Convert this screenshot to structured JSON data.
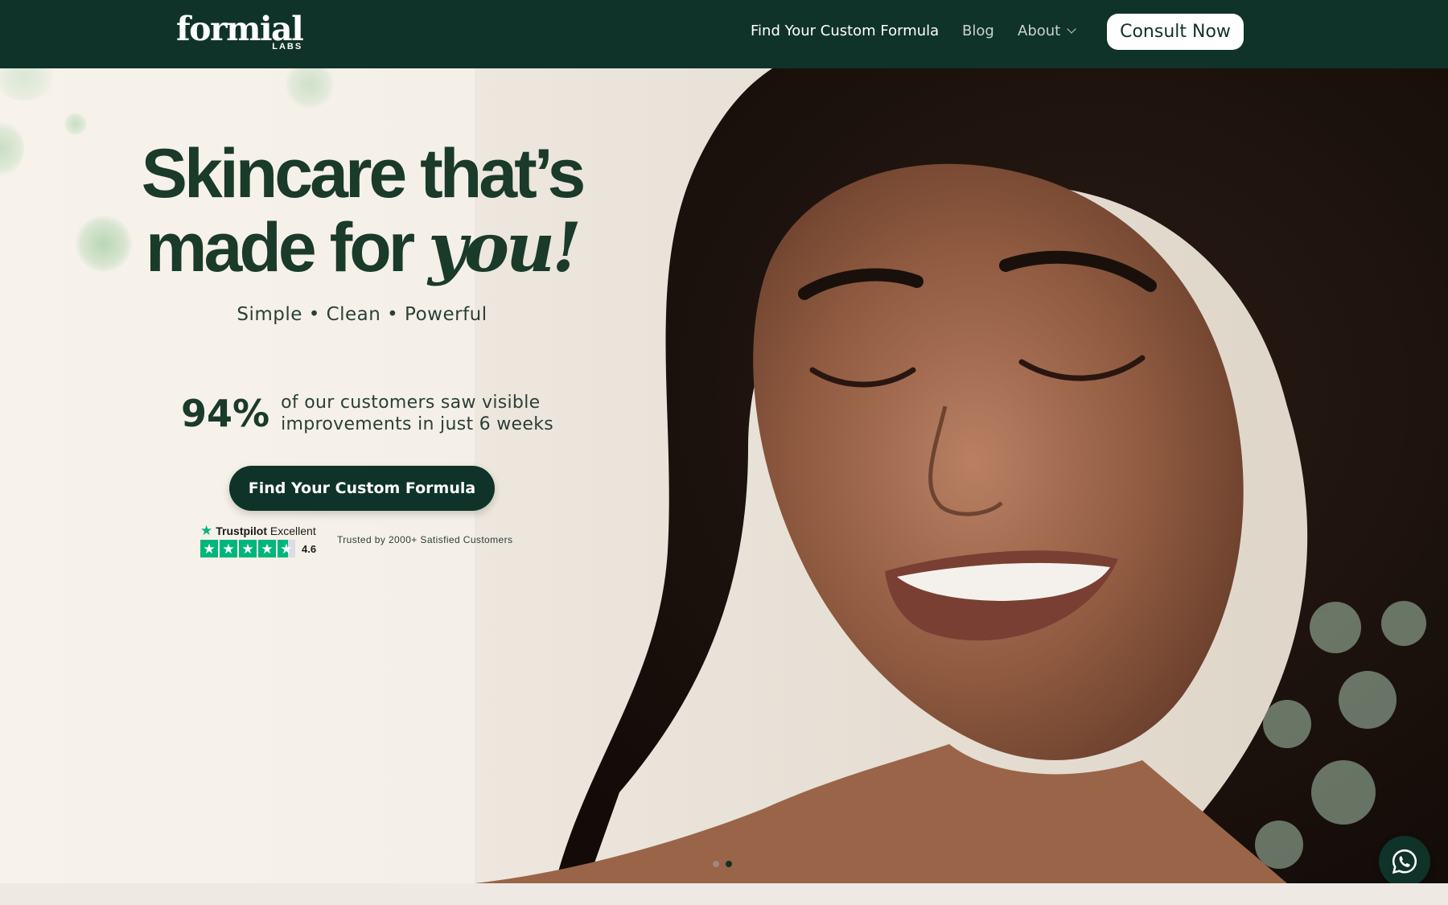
{
  "header": {
    "logo_text": "formial",
    "logo_sub": "LABS",
    "nav": {
      "custom_formula": "Find Your Custom Formula",
      "blog": "Blog",
      "about": "About"
    },
    "consult_label": "Consult Now"
  },
  "hero": {
    "headline_line1": "Skincare that’s",
    "headline_line2": "made for",
    "headline_accent": "you!",
    "tagline": "Simple • Clean • Powerful",
    "stat_value": "94%",
    "stat_line1": "of our customers saw visible",
    "stat_line2": "improvements in just 6 weeks",
    "cta_label": "Find Your Custom Formula",
    "trustpilot": {
      "brand": "Trustpilot",
      "rating_word": "Excellent",
      "score": "4.6",
      "trusted_text": "Trusted by 2000+ Satisfied Customers"
    },
    "carousel": {
      "slides": 2,
      "active": 2
    }
  },
  "icons": {
    "about_dropdown": "chevron-down-icon",
    "trustpilot": "star-icon",
    "chat": "whatsapp-icon"
  },
  "colors": {
    "brand_dark_green": "#0f3328",
    "headline_green": "#1a3a2a",
    "trustpilot_green": "#00b67a",
    "hero_background": "#f5f1ea"
  }
}
